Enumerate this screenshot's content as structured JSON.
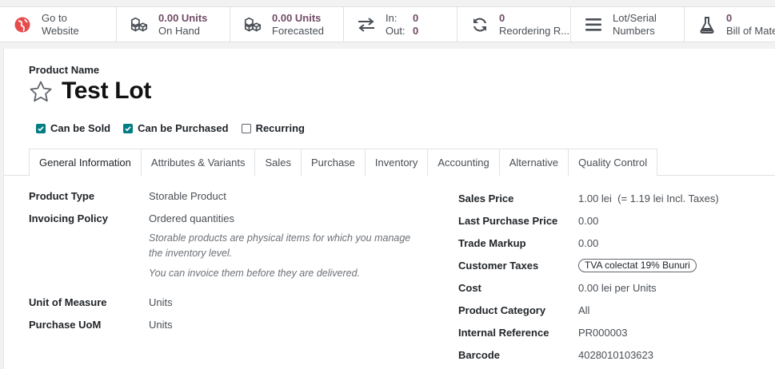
{
  "smart_buttons": {
    "website": {
      "line1": "Go to",
      "line2": "Website"
    },
    "on_hand": {
      "value": "0.00 Units",
      "label": "On Hand"
    },
    "forecasted": {
      "value": "0.00 Units",
      "label": "Forecasted"
    },
    "in_out": {
      "in_label": "In:",
      "in_value": "0",
      "out_label": "Out:",
      "out_value": "0"
    },
    "reordering": {
      "value": "0",
      "label": "Reordering R..."
    },
    "lots": {
      "line1": "Lot/Serial",
      "line2": "Numbers"
    },
    "bom": {
      "value": "0",
      "label": "Bill of Mate"
    }
  },
  "product": {
    "name_label": "Product Name",
    "name": "Test Lot",
    "checkboxes": [
      {
        "label": "Can be Sold",
        "checked": true
      },
      {
        "label": "Can be Purchased",
        "checked": true
      },
      {
        "label": "Recurring",
        "checked": false
      }
    ]
  },
  "tabs": [
    "General Information",
    "Attributes & Variants",
    "Sales",
    "Purchase",
    "Inventory",
    "Accounting",
    "Alternative",
    "Quality Control"
  ],
  "left_fields": {
    "product_type": {
      "label": "Product Type",
      "value": "Storable Product"
    },
    "invoicing_policy": {
      "label": "Invoicing Policy",
      "value": "Ordered quantities"
    },
    "help_1": "Storable products are physical items for which you manage",
    "help_2": "the inventory level.",
    "help_3": "You can invoice them before they are delivered.",
    "uom": {
      "label": "Unit of Measure",
      "value": "Units"
    },
    "purchase_uom": {
      "label": "Purchase UoM",
      "value": "Units"
    }
  },
  "right_fields": {
    "sales_price": {
      "label": "Sales Price",
      "value": "1.00 lei",
      "extra": "(= 1.19 lei Incl. Taxes)"
    },
    "last_purchase_price": {
      "label": "Last Purchase Price",
      "value": "0.00"
    },
    "trade_markup": {
      "label": "Trade Markup",
      "value": "0.00"
    },
    "customer_taxes": {
      "label": "Customer Taxes",
      "value": "TVA colectat 19% Bunuri"
    },
    "cost": {
      "label": "Cost",
      "value": "0.00 lei",
      "extra": "per Units"
    },
    "product_category": {
      "label": "Product Category",
      "value": "All"
    },
    "internal_reference": {
      "label": "Internal Reference",
      "value": "PR000003"
    },
    "barcode": {
      "label": "Barcode",
      "value": "4028010103623"
    }
  },
  "colors": {
    "accent": "#714b67",
    "teal": "#017e84",
    "website_icon": "#e74c4c"
  }
}
